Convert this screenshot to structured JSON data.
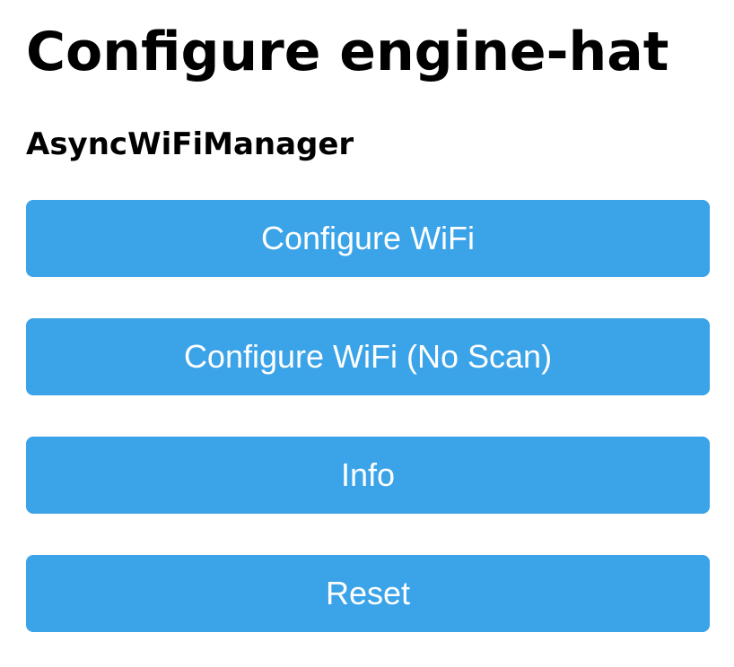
{
  "page": {
    "title": "Configure engine-hat",
    "subtitle": "AsyncWiFiManager"
  },
  "menu": {
    "buttons": [
      {
        "label": "Configure WiFi"
      },
      {
        "label": "Configure WiFi (No Scan)"
      },
      {
        "label": "Info"
      },
      {
        "label": "Reset"
      }
    ]
  },
  "colors": {
    "button_background": "#3ba3e8",
    "button_text": "#ffffff",
    "heading_text": "#000000",
    "page_background": "#ffffff"
  }
}
